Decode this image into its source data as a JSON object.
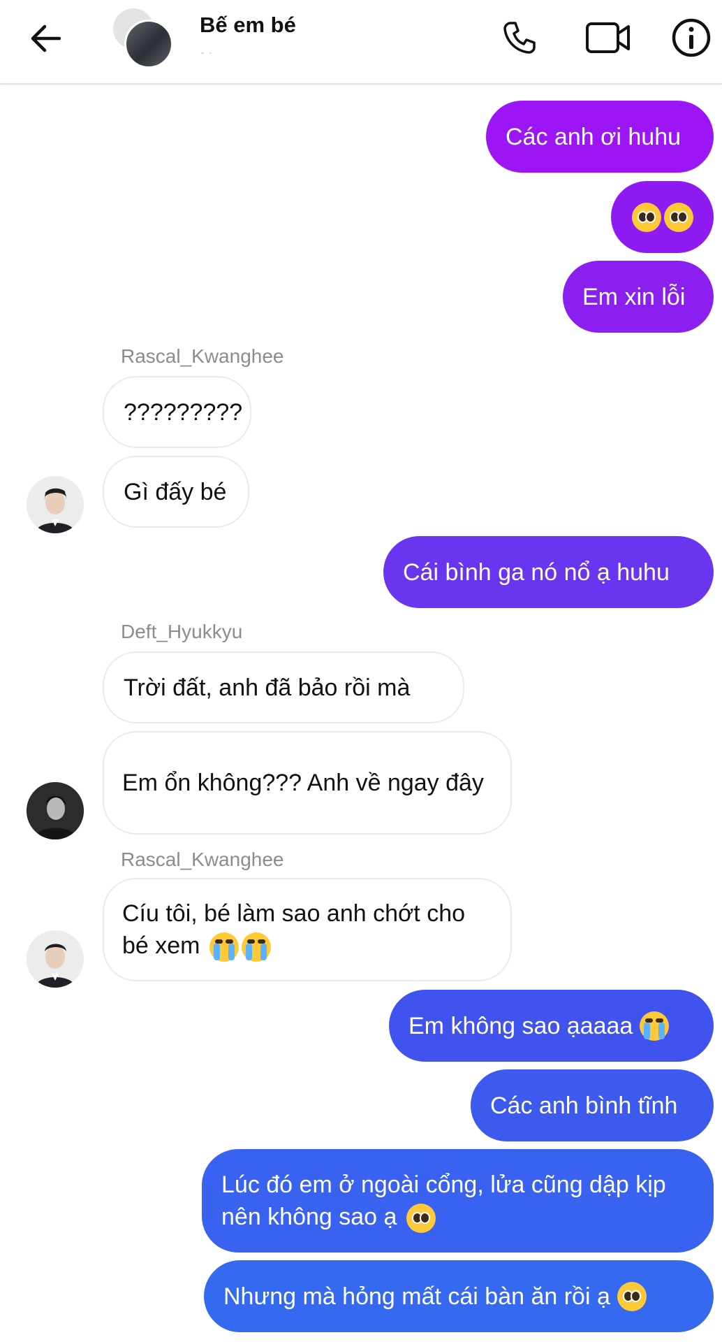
{
  "header": {
    "title": "Bế em bé",
    "subtitle": "- ·",
    "icons": [
      "back-arrow-icon",
      "phone-icon",
      "video-camera-icon",
      "info-icon"
    ]
  },
  "colors": {
    "purple": "#9b15f5",
    "violet": "#8a1ff0",
    "indigo": "#6a35ef",
    "blue": "#3f56ec",
    "royal": "#3569ef"
  },
  "messages": [
    {
      "side": "out",
      "text": "Các anh ơi huhu"
    },
    {
      "side": "out",
      "text": "",
      "emoji": "pleading-face x2"
    },
    {
      "side": "out",
      "text": "Em xin lỗi"
    },
    {
      "side": "in",
      "sender": "Rascal_Kwanghee",
      "text": "?????????"
    },
    {
      "side": "in",
      "text": "Gì đấy bé"
    },
    {
      "side": "out",
      "text": "Cái bình ga nó nổ ạ huhu"
    },
    {
      "side": "in",
      "sender": "Deft_Hyukkyu",
      "text": "Trời đất, anh đã bảo rồi mà"
    },
    {
      "side": "in",
      "text": "Em ổn không??? Anh về ngay đây"
    },
    {
      "side": "in",
      "sender": "Rascal_Kwanghee",
      "text": "Cíu tôi, bé làm sao anh chớt cho bé xem",
      "emoji": "crying-face x2"
    },
    {
      "side": "out",
      "text": "Em không sao ạaaaa",
      "emoji": "crying-face"
    },
    {
      "side": "out",
      "text": "Các anh bình tĩnh"
    },
    {
      "side": "out",
      "text": "Lúc đó em ở ngoài cổng, lửa cũng dập kịp nên không sao ạ",
      "emoji": "pleading-face"
    },
    {
      "side": "out",
      "text": "Nhưng mà hỏng mất cái bàn ăn rồi ạ",
      "emoji": "pleading-face"
    }
  ]
}
